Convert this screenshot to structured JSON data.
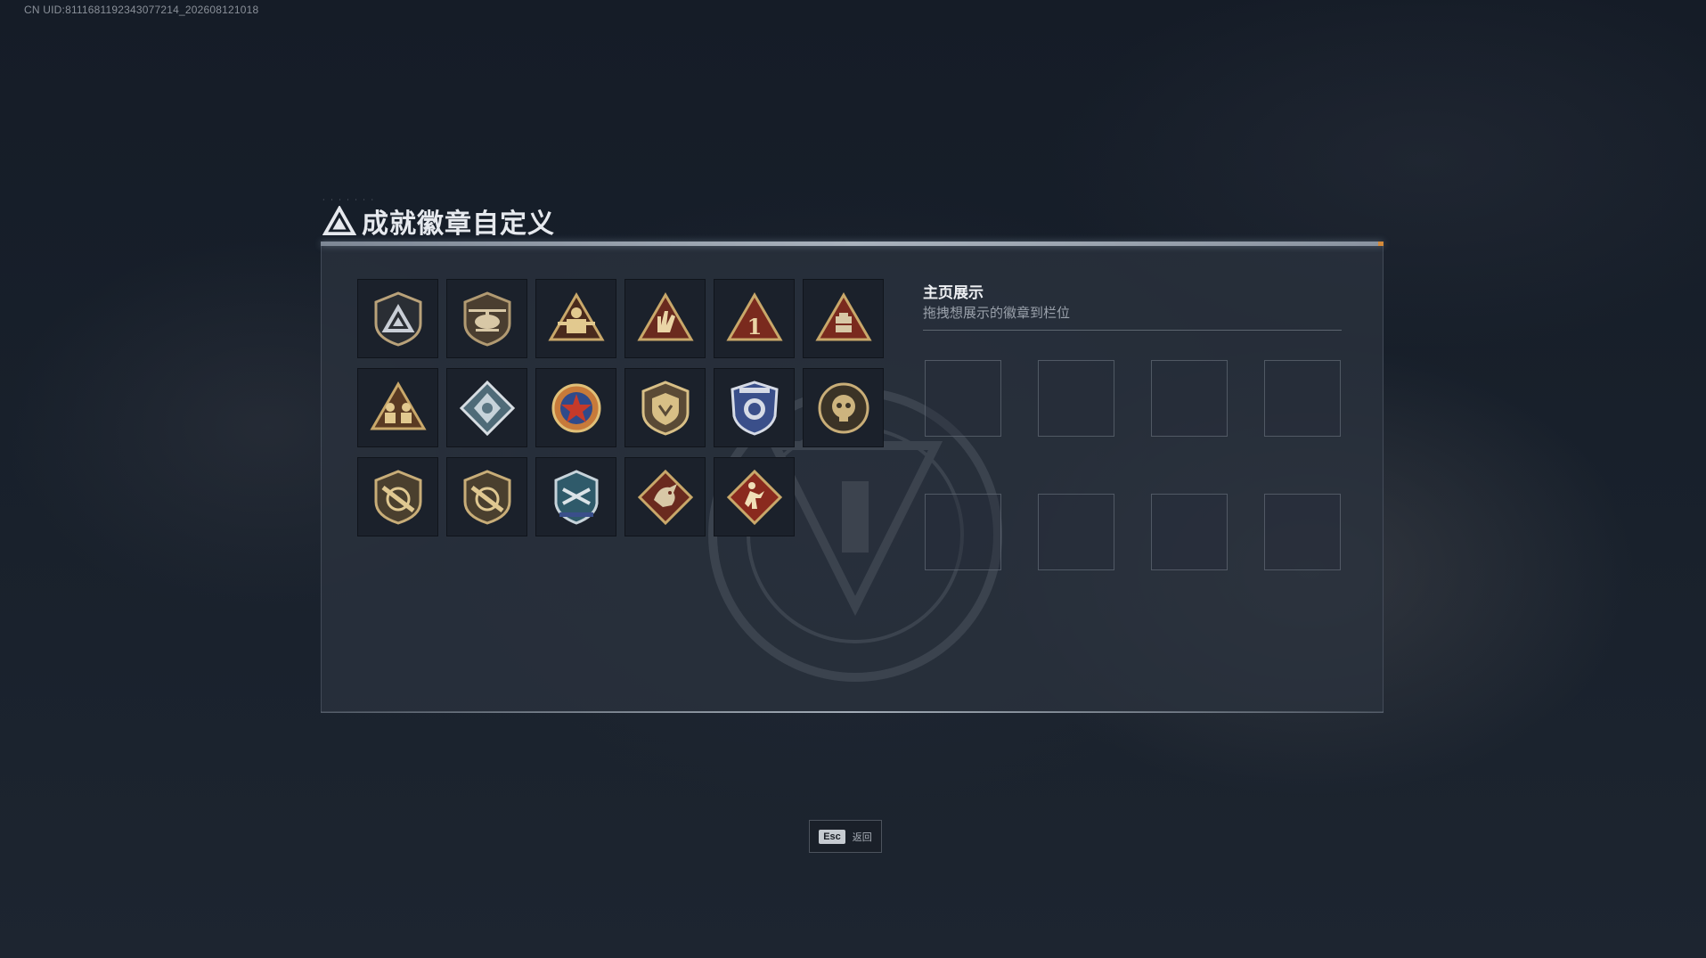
{
  "uid_text": "CN UID:8111681192343077214_202608121018",
  "header": {
    "title": "成就徽章自定义",
    "logo_icon": "triangle-logo-icon"
  },
  "badges": [
    {
      "icon": "shield-triangle-badge-icon"
    },
    {
      "icon": "helicopter-badge-icon"
    },
    {
      "icon": "soldier-triangle-badge-icon"
    },
    {
      "icon": "hand-sign-triangle-badge-icon"
    },
    {
      "icon": "number-one-triangle-badge-icon",
      "label": "1"
    },
    {
      "icon": "crate-triangle-badge-icon"
    },
    {
      "icon": "squad-triangle-badge-icon"
    },
    {
      "icon": "silver-diamond-badge-icon"
    },
    {
      "icon": "star-medal-badge-icon"
    },
    {
      "icon": "gold-shield-badge-icon"
    },
    {
      "icon": "blue-police-badge-icon"
    },
    {
      "icon": "gold-skull-round-badge-icon"
    },
    {
      "icon": "rifle-shield-badge-icon"
    },
    {
      "icon": "rifle-shield-badge-2-icon"
    },
    {
      "icon": "blue-crest-badge-icon"
    },
    {
      "icon": "dragon-diamond-badge-icon"
    },
    {
      "icon": "runner-diamond-badge-icon"
    }
  ],
  "showcase": {
    "title": "主页展示",
    "subtitle": "拖拽想展示的徽章到栏位",
    "slot_count": 8
  },
  "footer": {
    "key": "Esc",
    "label": "返回"
  },
  "colors": {
    "gold": "#c9a86a",
    "bronze": "#7a5636",
    "red": "#8a2a1e",
    "blue": "#3a4f8a",
    "accent_orange": "#d48a3a"
  }
}
